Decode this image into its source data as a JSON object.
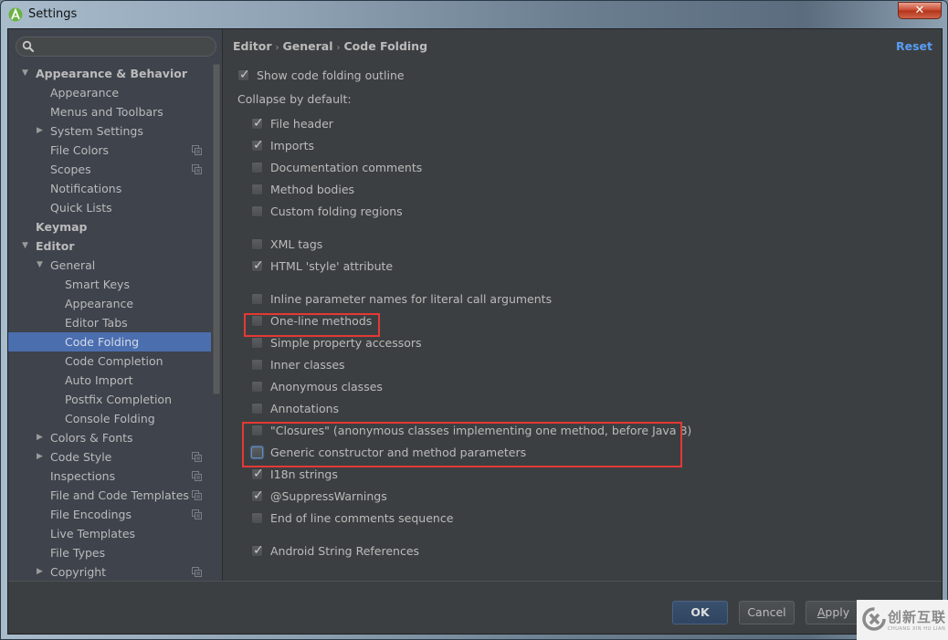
{
  "window": {
    "title": "Settings",
    "close_label": "✕"
  },
  "search": {
    "placeholder": "",
    "value": ""
  },
  "sidebar": {
    "items": [
      {
        "label": "Appearance & Behavior",
        "level": 0,
        "bold": true,
        "arrow": "▼",
        "shared": false,
        "selected": false
      },
      {
        "label": "Appearance",
        "level": 1,
        "bold": false,
        "arrow": "",
        "shared": false,
        "selected": false
      },
      {
        "label": "Menus and Toolbars",
        "level": 1,
        "bold": false,
        "arrow": "",
        "shared": false,
        "selected": false
      },
      {
        "label": "System Settings",
        "level": 1,
        "bold": false,
        "arrow": "▶",
        "shared": false,
        "selected": false
      },
      {
        "label": "File Colors",
        "level": 1,
        "bold": false,
        "arrow": "",
        "shared": true,
        "selected": false
      },
      {
        "label": "Scopes",
        "level": 1,
        "bold": false,
        "arrow": "",
        "shared": true,
        "selected": false
      },
      {
        "label": "Notifications",
        "level": 1,
        "bold": false,
        "arrow": "",
        "shared": false,
        "selected": false
      },
      {
        "label": "Quick Lists",
        "level": 1,
        "bold": false,
        "arrow": "",
        "shared": false,
        "selected": false
      },
      {
        "label": "Keymap",
        "level": 0,
        "bold": true,
        "arrow": "",
        "shared": false,
        "selected": false
      },
      {
        "label": "Editor",
        "level": 0,
        "bold": true,
        "arrow": "▼",
        "shared": false,
        "selected": false
      },
      {
        "label": "General",
        "level": 1,
        "bold": false,
        "arrow": "▼",
        "shared": false,
        "selected": false
      },
      {
        "label": "Smart Keys",
        "level": 2,
        "bold": false,
        "arrow": "",
        "shared": false,
        "selected": false
      },
      {
        "label": "Appearance",
        "level": 2,
        "bold": false,
        "arrow": "",
        "shared": false,
        "selected": false
      },
      {
        "label": "Editor Tabs",
        "level": 2,
        "bold": false,
        "arrow": "",
        "shared": false,
        "selected": false
      },
      {
        "label": "Code Folding",
        "level": 2,
        "bold": false,
        "arrow": "",
        "shared": false,
        "selected": true
      },
      {
        "label": "Code Completion",
        "level": 2,
        "bold": false,
        "arrow": "",
        "shared": false,
        "selected": false
      },
      {
        "label": "Auto Import",
        "level": 2,
        "bold": false,
        "arrow": "",
        "shared": false,
        "selected": false
      },
      {
        "label": "Postfix Completion",
        "level": 2,
        "bold": false,
        "arrow": "",
        "shared": false,
        "selected": false
      },
      {
        "label": "Console Folding",
        "level": 2,
        "bold": false,
        "arrow": "",
        "shared": false,
        "selected": false
      },
      {
        "label": "Colors & Fonts",
        "level": 1,
        "bold": false,
        "arrow": "▶",
        "shared": false,
        "selected": false
      },
      {
        "label": "Code Style",
        "level": 1,
        "bold": false,
        "arrow": "▶",
        "shared": true,
        "selected": false
      },
      {
        "label": "Inspections",
        "level": 1,
        "bold": false,
        "arrow": "",
        "shared": true,
        "selected": false
      },
      {
        "label": "File and Code Templates",
        "level": 1,
        "bold": false,
        "arrow": "",
        "shared": true,
        "selected": false
      },
      {
        "label": "File Encodings",
        "level": 1,
        "bold": false,
        "arrow": "",
        "shared": true,
        "selected": false
      },
      {
        "label": "Live Templates",
        "level": 1,
        "bold": false,
        "arrow": "",
        "shared": false,
        "selected": false
      },
      {
        "label": "File Types",
        "level": 1,
        "bold": false,
        "arrow": "",
        "shared": false,
        "selected": false
      },
      {
        "label": "Copyright",
        "level": 1,
        "bold": false,
        "arrow": "▶",
        "shared": true,
        "selected": false
      }
    ]
  },
  "content": {
    "breadcrumb": [
      "Editor",
      "General",
      "Code Folding"
    ],
    "breadcrumb_sep": "›",
    "reset_label": "Reset",
    "show_outline": {
      "label": "Show code folding outline",
      "checked": true
    },
    "collapse_label": "Collapse by default:",
    "options": [
      {
        "label": "File header",
        "checked": true,
        "focused": false
      },
      {
        "label": "Imports",
        "checked": true,
        "focused": false
      },
      {
        "label": "Documentation comments",
        "checked": false,
        "focused": false
      },
      {
        "label": "Method bodies",
        "checked": false,
        "focused": false
      },
      {
        "label": "Custom folding regions",
        "checked": false,
        "focused": false
      },
      {
        "label": "XML tags",
        "checked": false,
        "focused": false
      },
      {
        "label": "HTML 'style' attribute",
        "checked": true,
        "focused": false
      },
      {
        "label": "Inline parameter names for literal call arguments",
        "checked": false,
        "focused": false
      },
      {
        "label": "One-line methods",
        "checked": false,
        "focused": false
      },
      {
        "label": "Simple property accessors",
        "checked": false,
        "focused": false
      },
      {
        "label": "Inner classes",
        "checked": false,
        "focused": false
      },
      {
        "label": "Anonymous classes",
        "checked": false,
        "focused": false
      },
      {
        "label": "Annotations",
        "checked": false,
        "focused": false
      },
      {
        "label": "\"Closures\" (anonymous classes implementing one method, before Java 8)",
        "checked": false,
        "focused": false
      },
      {
        "label": "Generic constructor and method parameters",
        "checked": false,
        "focused": true
      },
      {
        "label": "I18n strings",
        "checked": true,
        "focused": false
      },
      {
        "label": "@SuppressWarnings",
        "checked": true,
        "focused": false
      },
      {
        "label": "End of line comments sequence",
        "checked": false,
        "focused": false
      },
      {
        "label": "Android String References",
        "checked": true,
        "focused": false
      }
    ]
  },
  "footer": {
    "ok_label": "OK",
    "cancel_label": "Cancel",
    "apply_mnemonic": "A",
    "apply_rest": "pply"
  },
  "watermark": {
    "text": "创新互联",
    "sub": "CHUANG XIN HU LIAN"
  },
  "colors": {
    "accent": "#4b6eaf",
    "link": "#589df6",
    "highlight_box": "#e53935"
  }
}
